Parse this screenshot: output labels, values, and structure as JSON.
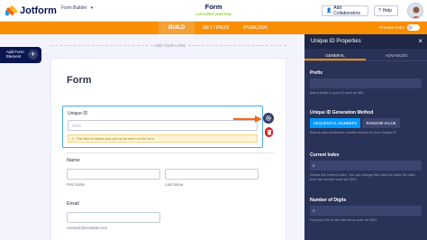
{
  "header": {
    "logo_text": "Jotform",
    "builder_label": "Form Builder",
    "form_title": "Form",
    "form_subtitle": "Last edited yesterday",
    "collab_label": "Add Collaborators",
    "help_label": "Help"
  },
  "tabs": [
    {
      "label": "BUILD"
    },
    {
      "label": "SETTINGS"
    },
    {
      "label": "PUBLISH"
    }
  ],
  "preview_label": "Preview Form",
  "left": {
    "add_element_line1": "Add Form",
    "add_element_line2": "Element",
    "add_logo": "+ ADD YOUR LOGO"
  },
  "form": {
    "title": "Form",
    "unique_id_label": "Unique ID",
    "unique_id_value": "0000",
    "warning": "This field is hidden and will not be seen on the form.",
    "name_label": "Name",
    "first_name": "First Name",
    "last_name": "Last Name",
    "email_label": "Email",
    "email_hint": "example@example.com"
  },
  "panel": {
    "title": "Unique ID Properties",
    "tab_general": "GENERAL",
    "tab_advanced": "ADVANCED",
    "prefix_title": "Prefix",
    "prefix_desc": "Add a prefix to your ID such as WD.",
    "method_title": "Unique ID Generation Method",
    "method_sequential": "SEQUENTIAL NUMBERS",
    "method_random": "RANDOM VALUE",
    "method_desc": "Add an auto-increment number section to your Unique ID",
    "current_title": "Current Index",
    "current_value": "0",
    "current_desc": "Shows the current index. You can change this value to make IDs start from the number such as 1000.",
    "digits_title": "Number of Digits",
    "digits_value": "4",
    "digits_desc": "Pad your IDs to left with zeros such as 0001."
  },
  "colors": {
    "accent": "#f98e03",
    "navy": "#0a1551",
    "panel_bg": "#293257",
    "selected_border": "#4aa8e9"
  }
}
